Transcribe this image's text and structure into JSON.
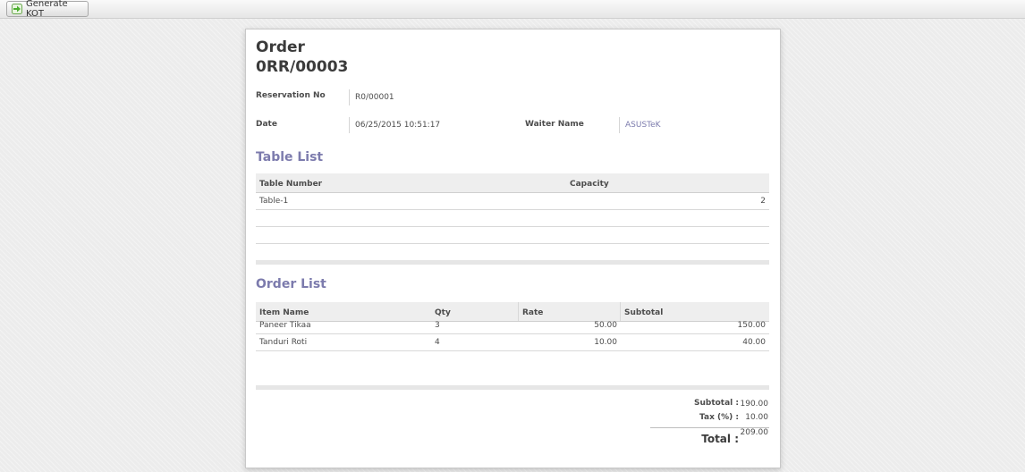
{
  "toolbar": {
    "generate_kot_label": "Generate KOT",
    "icon": "arrow-right-icon"
  },
  "order": {
    "title": "Order",
    "number": "0RR/00003",
    "reservation_label": "Reservation No",
    "reservation_value": "R0/00001",
    "date_label": "Date",
    "date_value": "06/25/2015 10:51:17",
    "waiter_label": "Waiter Name",
    "waiter_value": "ASUSTeK"
  },
  "table_list": {
    "heading": "Table List",
    "columns": [
      "Table Number",
      "Capacity"
    ],
    "rows": [
      {
        "table_number": "Table-1",
        "capacity": "2"
      }
    ]
  },
  "order_list": {
    "heading": "Order List",
    "columns": [
      "Item Name",
      "Qty",
      "Rate",
      "Subtotal"
    ],
    "rows": [
      {
        "item": "Paneer Tikaa",
        "qty": "3",
        "rate": "50.00",
        "subtotal": "150.00"
      },
      {
        "item": "Tanduri Roti",
        "qty": "4",
        "rate": "10.00",
        "subtotal": "40.00"
      }
    ]
  },
  "totals": {
    "subtotal_label": "Subtotal :",
    "subtotal_value": "190.00",
    "tax_label": "Tax (%) :",
    "tax_value": "10.00",
    "total_label": "Total :",
    "total_value": "209.00"
  },
  "colors": {
    "accent": "#7c7bad",
    "button_icon": "#4caf2f"
  }
}
